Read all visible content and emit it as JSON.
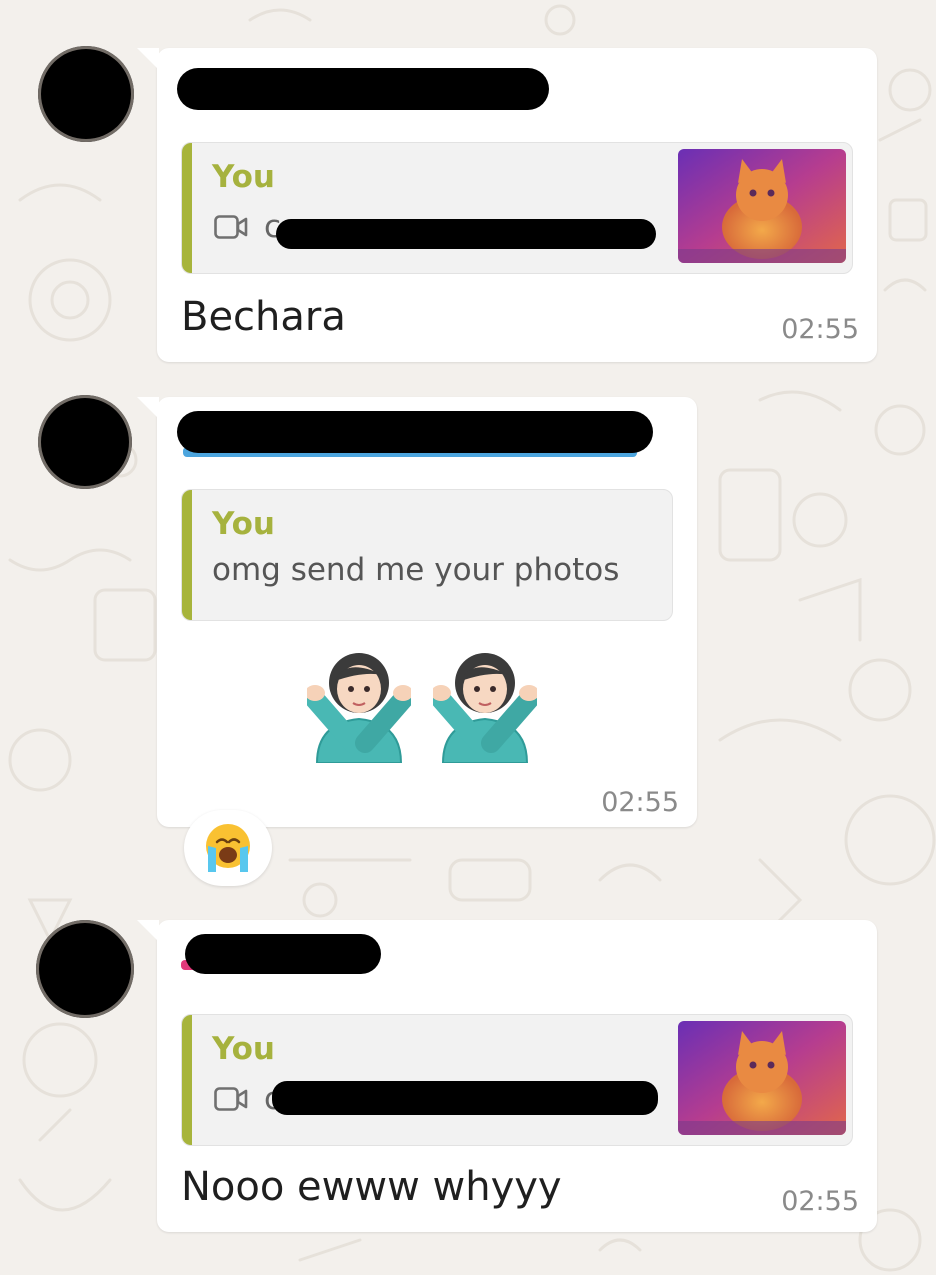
{
  "chat": {
    "messages": [
      {
        "quote_author": "You",
        "quote_type_icon": "video-camera-icon",
        "quote_caption_visible": "c",
        "text": "Bechara",
        "time": "02:55"
      },
      {
        "quote_author": "You",
        "quote_text": "omg send me your photos",
        "emojis": [
          "person-gesturing-no-emoji",
          "person-gesturing-no-emoji"
        ],
        "time": "02:55",
        "reaction": "loudly-crying-face-emoji"
      },
      {
        "quote_author": "You",
        "quote_type_icon": "video-camera-icon",
        "quote_caption_visible": "c",
        "text": "Nooo ewww whyyy",
        "time": "02:55"
      }
    ]
  },
  "colors": {
    "background": "#f3f0ec",
    "bubble": "#ffffff",
    "quote_bar": "#a7b43b",
    "quote_author": "#a6b23e",
    "timestamp": "#8a8a8a",
    "sender_hint_blue": "#1f8fd6",
    "sender_hint_pink": "#e0397a"
  }
}
